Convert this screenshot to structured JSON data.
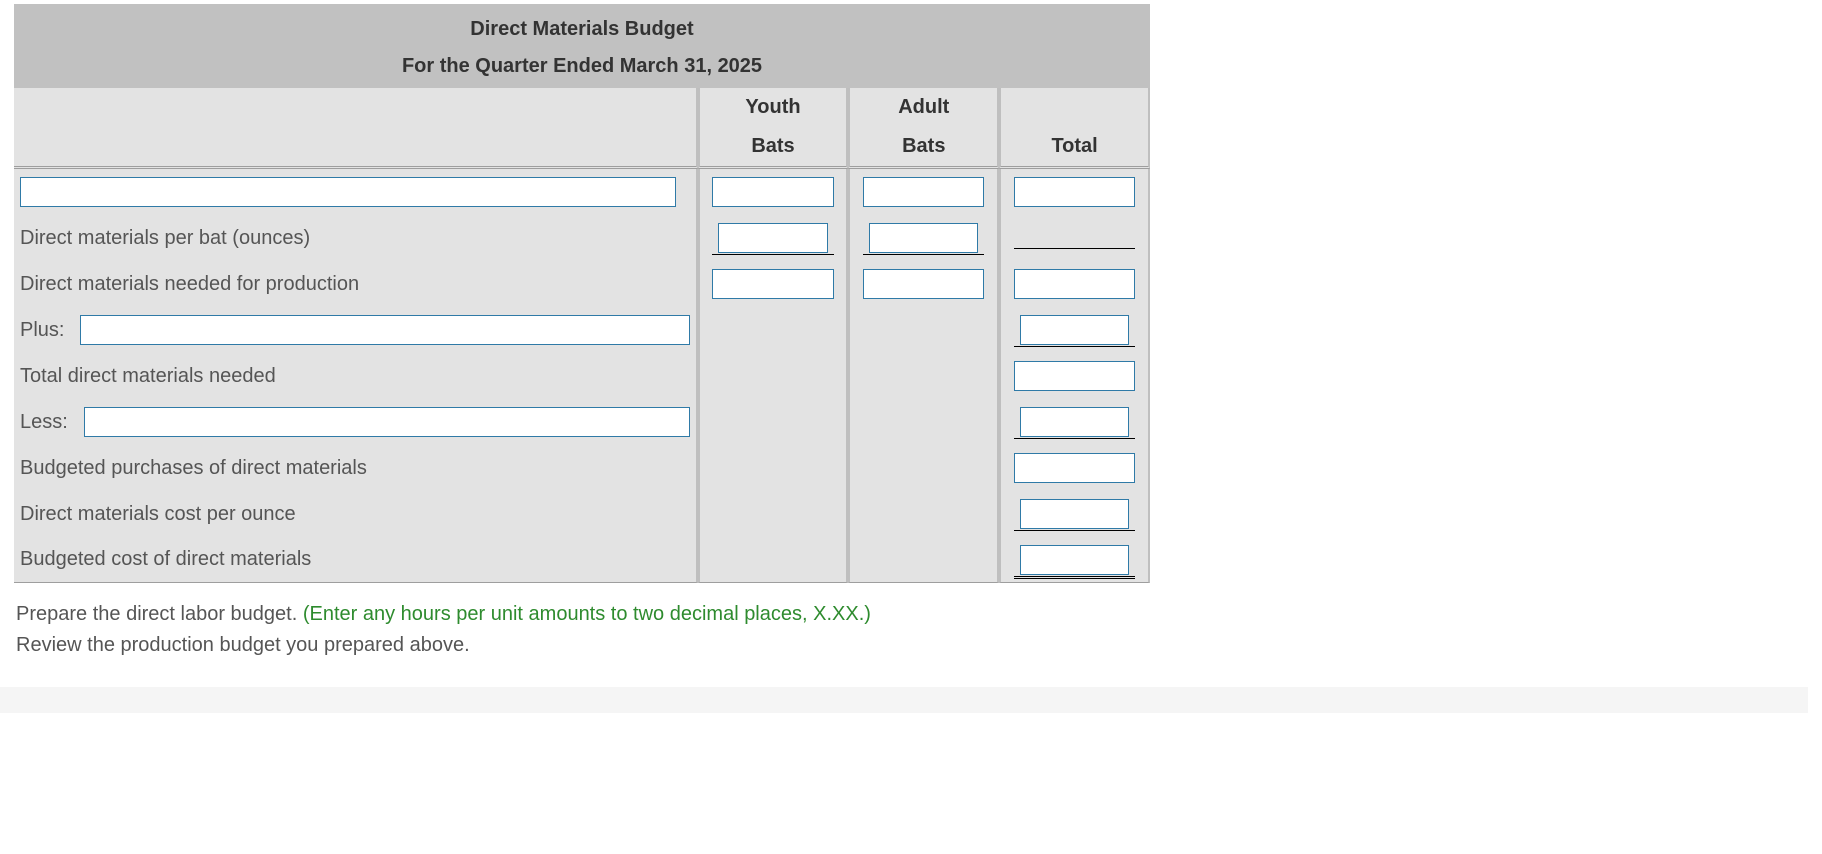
{
  "header": {
    "title": "Direct Materials Budget",
    "subtitle": "For the Quarter Ended March 31, 2025"
  },
  "columns": {
    "c1_line1": "Youth",
    "c1_line2": "Bats",
    "c2_line1": "Adult",
    "c2_line2": "Bats",
    "c3_line1": "",
    "c3_line2": "Total"
  },
  "rows": {
    "r1_label_input": "",
    "r2_label": "Direct materials per bat (ounces)",
    "r3_label": "Direct materials needed for production",
    "r4_prefix": "Plus:",
    "r4_input": "",
    "r5_label": "Total direct materials needed",
    "r6_prefix": "Less:",
    "r6_input": "",
    "r7_label": "Budgeted purchases of direct materials",
    "r8_label": "Direct materials cost per ounce",
    "r9_label": "Budgeted cost of direct materials"
  },
  "instructions": {
    "line1_a": "Prepare the direct labor budget. ",
    "line1_b": "(Enter any hours per unit amounts to two decimal places, X.XX.)",
    "line2": "Review the production budget you prepared above."
  }
}
